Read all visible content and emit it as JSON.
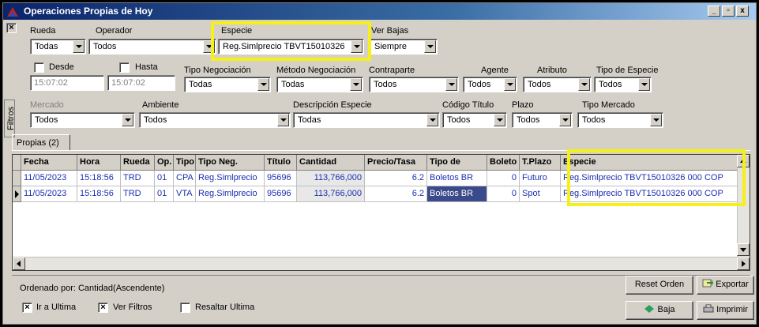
{
  "window": {
    "title": "Operaciones Propias de Hoy",
    "controls": [
      "_",
      "▫",
      "x"
    ]
  },
  "side_tab": "Filtros",
  "filters": {
    "rueda": {
      "label": "Rueda",
      "value": "Todas"
    },
    "operador": {
      "label": "Operador",
      "value": "Todos"
    },
    "especie": {
      "label": "Especie",
      "value": "Reg.Simlprecio TBVT15010326"
    },
    "ver_bajas": {
      "label": "Ver Bajas",
      "value": "Siempre"
    },
    "desde": {
      "label": "Desde",
      "value": "15:07:02",
      "checked": false
    },
    "hasta": {
      "label": "Hasta",
      "value": "15:07:02",
      "checked": false
    },
    "tipo_negociacion": {
      "label": "Tipo Negociación",
      "value": "Todas"
    },
    "metodo_negociacion": {
      "label": "Método Negociación",
      "value": "Todas"
    },
    "contraparte": {
      "label": "Contraparte",
      "value": "Todos"
    },
    "agente": {
      "label": "Agente",
      "value": "Todos"
    },
    "atributo": {
      "label": "Atributo",
      "value": "Todos"
    },
    "tipo_especie": {
      "label": "Tipo de Especie",
      "value": "Todos"
    },
    "mercado": {
      "label": "Mercado",
      "value": "Todos"
    },
    "ambiente": {
      "label": "Ambiente",
      "value": "Todos"
    },
    "descripcion_especie": {
      "label": "Descripción Especie",
      "value": "Todas"
    },
    "codigo_titulo": {
      "label": "Código Título",
      "value": "Todos"
    },
    "plazo": {
      "label": "Plazo",
      "value": "Todos"
    },
    "tipo_mercado": {
      "label": "Tipo Mercado",
      "value": "Todos"
    }
  },
  "tab": {
    "label": "Propias (2)"
  },
  "grid": {
    "columns": [
      "Fecha",
      "Hora",
      "Rueda",
      "Op.",
      "Tipo",
      "Tipo Neg.",
      "Título",
      "Cantidad",
      "Precio/Tasa",
      "Tipo de",
      "Boleto",
      "T.Plazo",
      "Especie"
    ],
    "rows": [
      [
        "11/05/2023",
        "15:18:56",
        "TRD",
        "01",
        "CPA",
        "Reg.Simlprecio",
        "95696",
        "113,766,000",
        "6.2",
        "Boletos BR",
        "0",
        "Futuro",
        "Reg.Simlprecio TBVT15010326 000 COP"
      ],
      [
        "11/05/2023",
        "15:18:56",
        "TRD",
        "01",
        "VTA",
        "Reg.Simlprecio",
        "95696",
        "113,766,000",
        "6.2",
        "Boletos BR",
        "0",
        "Spot",
        "Reg.Simlprecio TBVT15010326 000 COP"
      ]
    ]
  },
  "footer": {
    "ordenado": "Ordenado por: Cantidad(Ascendente)",
    "ir_ultima": {
      "label": "Ir a Ultima",
      "checked": true
    },
    "ver_filtros": {
      "label": "Ver Filtros",
      "checked": true
    },
    "resaltar_ultima": {
      "label": "Resaltar Ultima",
      "checked": false
    },
    "reset_orden": "Reset Orden",
    "exportar": "Exportar",
    "baja": "Baja",
    "imprimir": "Imprimir"
  },
  "colors": {
    "highlight": "#f5f017",
    "row_text": "#1c2fb0",
    "titlebar": "#0a246a"
  }
}
